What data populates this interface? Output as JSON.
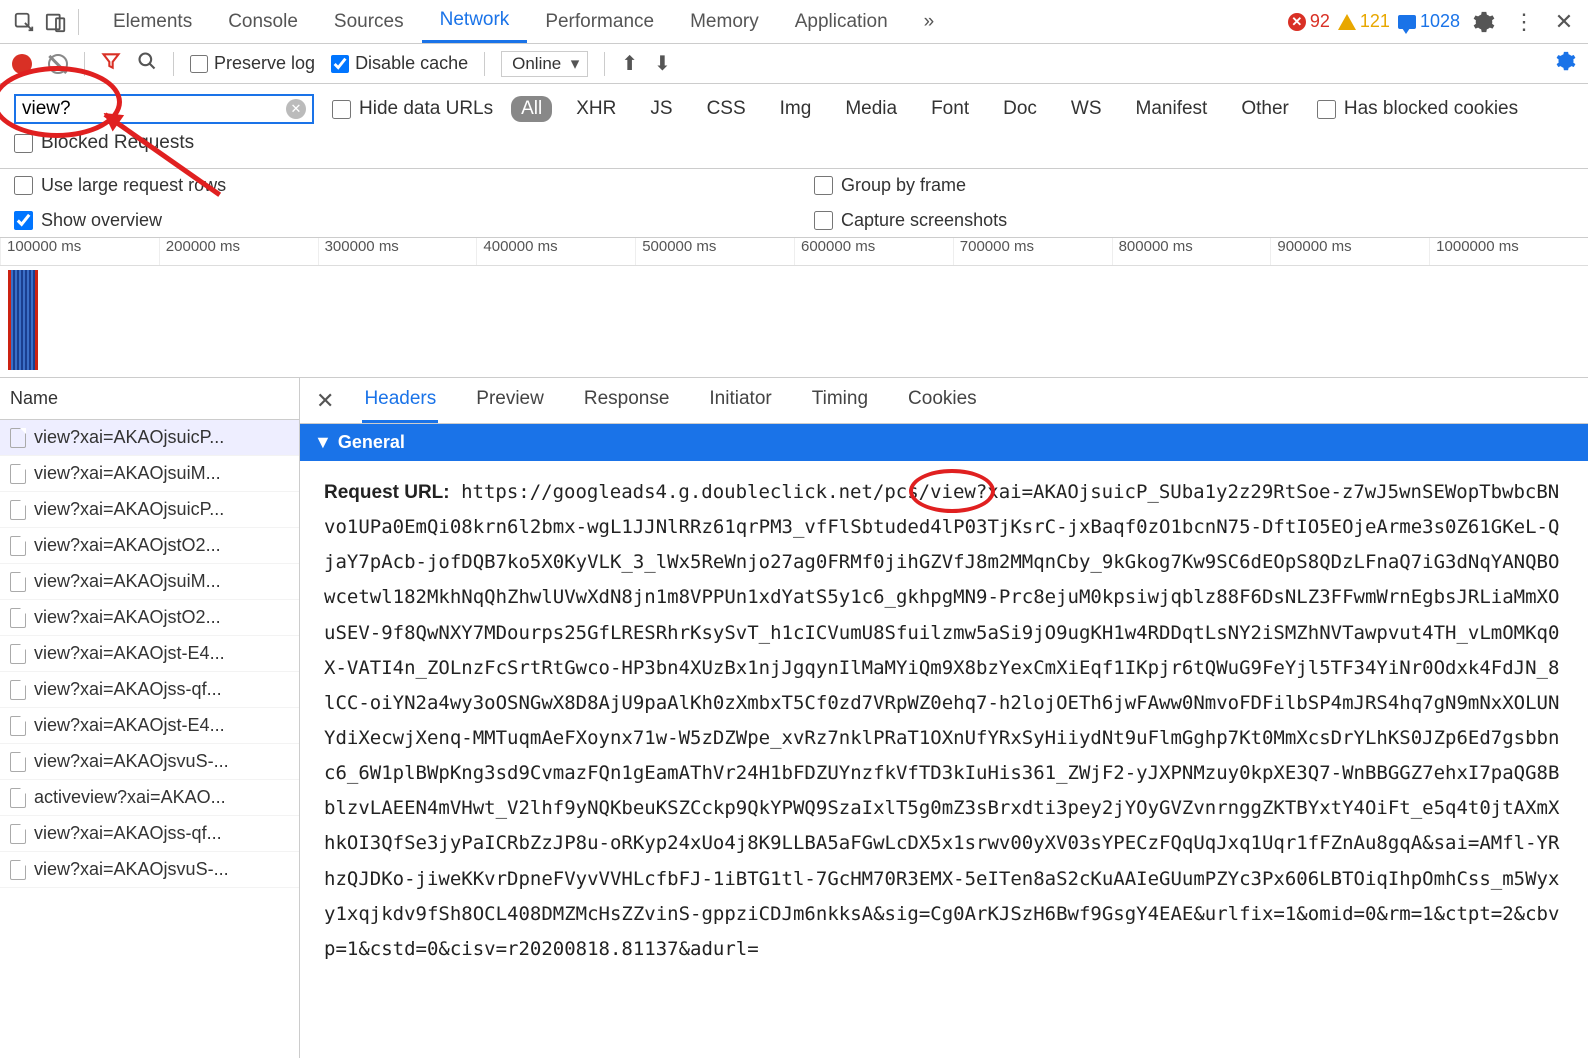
{
  "top": {
    "tabs": [
      "Elements",
      "Console",
      "Sources",
      "Network",
      "Performance",
      "Memory",
      "Application"
    ],
    "more": "»",
    "activeIndex": 3,
    "errors": "92",
    "warnings": "121",
    "messages": "1028"
  },
  "toolbar": {
    "preserve_log": "Preserve log",
    "disable_cache": "Disable cache",
    "throttle": "Online"
  },
  "filter": {
    "value": "view?",
    "hide_data_urls": "Hide data URLs",
    "types": [
      "All",
      "XHR",
      "JS",
      "CSS",
      "Img",
      "Media",
      "Font",
      "Doc",
      "WS",
      "Manifest",
      "Other"
    ],
    "activeType": 0,
    "has_blocked_cookies": "Has blocked cookies",
    "blocked_requests": "Blocked Requests"
  },
  "options": {
    "large_rows": "Use large request rows",
    "show_overview": "Show overview",
    "group_frame": "Group by frame",
    "capture_ss": "Capture screenshots"
  },
  "timeline": {
    "ticks": [
      "100000 ms",
      "200000 ms",
      "300000 ms",
      "400000 ms",
      "500000 ms",
      "600000 ms",
      "700000 ms",
      "800000 ms",
      "900000 ms",
      "1000000 ms"
    ]
  },
  "reqlist": {
    "header": "Name",
    "items": [
      "view?xai=AKAOjsuicP...",
      "view?xai=AKAOjsuiM...",
      "view?xai=AKAOjsuicP...",
      "view?xai=AKAOjstO2...",
      "view?xai=AKAOjsuiM...",
      "view?xai=AKAOjstO2...",
      "view?xai=AKAOjst-E4...",
      "view?xai=AKAOjss-qf...",
      "view?xai=AKAOjst-E4...",
      "view?xai=AKAOjsvuS-...",
      "activeview?xai=AKAO...",
      "view?xai=AKAOjss-qf...",
      "view?xai=AKAOjsvuS-..."
    ]
  },
  "detail": {
    "tabs": [
      "Headers",
      "Preview",
      "Response",
      "Initiator",
      "Timing",
      "Cookies"
    ],
    "activeIndex": 0,
    "general_label": "General",
    "request_url_label": "Request URL:",
    "url_pre": "https://googleads4.g.doubleclick.net/pcs",
    "url_view": "/view?",
    "url_post": "xai=AKAOjsuicP_SUba1y2z29RtSoe-z7wJ5wnSEWopTbwbcBNvo1UPa0EmQi08krn6l2bmx-wgL1JJNlRRz61qrPM3_vfFlSbtuded4lP03TjKsrC-jxBaqf0zO1bcnN75-DftIO5EOjeArme3s0Z61GKeL-QjaY7pAcb-jofDQB7ko5X0KyVLK_3_lWx5ReWnjo27ag0FRMf0jihGZVfJ8m2MMqnCby_9kGkog7Kw9SC6dEOpS8QDzLFnaQ7iG3dNqYANQBOwcetwl182MkhNqQhZhwlUVwXdN8jn1m8VPPUn1xdYatS5y1c6_gkhpgMN9-Prc8ejuM0kpsiwjqblz88F6DsNLZ3FFwmWrnEgbsJRLiaMmXOuSEV-9f8QwNXY7MDourps25GfLRESRhrKsySvT_h1cICVumU8Sfuilzmw5aSi9jO9ugKH1w4RDDqtLsNY2iSMZhNVTawpvut4TH_vLmOMKq0X-VATI4n_ZOLnzFcSrtRtGwco-HP3bn4XUzBx1njJgqynIlMaMYiQm9X8bzYexCmXiEqf1IKpjr6tQWuG9FeYjl5TF34YiNr0Odxk4FdJN_8lCC-oiYN2a4wy3oOSNGwX8D8AjU9paAlKh0zXmbxT5Cf0zd7VRpWZ0ehq7-h2lojOETh6jwFAww0NmvoFDFilbSP4mJRS4hq7gN9mNxXOLUNYdiXecwjXenq-MMTuqmAeFXoynx71w-W5zDZWpe_xvRz7nklPRaT1OXnUfYRxSyHiiydNt9uFlmGghp7Kt0MmXcsDrYLhKS0JZp6Ed7gsbbnc6_6W1plBWpKng3sd9CvmazFQn1gEamAThVr24H1bFDZUYnzfkVfTD3kIuHis361_ZWjF2-yJXPNMzuy0kpXE3Q7-WnBBGGZ7ehxI7paQG8BblzvLAEEN4mVHwt_V2lhf9yNQKbeuKSZCckp9QkYPWQ9SzaIxlT5g0mZ3sBrxdti3pey2jYOyGVZvnrnggZKTBYxtY4OiFt_e5q4t0jtAXmXhkOI3QfSe3jyPaICRbZzJP8u-oRKyp24xUo4j8K9LLBA5aFGwLcDX5x1srwv00yXV03sYPECzFQqUqJxq1Uqr1fFZnAu8gqA&sai=AMfl-YRhzQJDKo-jiweKKvrDpneFVyvVVHLcfbFJ-1iBTG1tl-7GcHM70R3EMX-5eITen8aS2cKuAAIeGUumPZYc3Px606LBTOiqIhpOmhCss_m5Wyxy1xqjkdv9fSh8OCL408DMZMcHsZZvinS-gppziCDJm6nkksA&sig=Cg0ArKJSzH6Bwf9GsgY4EAE&urlfix=1&omid=0&rm=1&ctpt=2&cbvp=1&cstd=0&cisv=r20200818.81137&adurl="
  }
}
